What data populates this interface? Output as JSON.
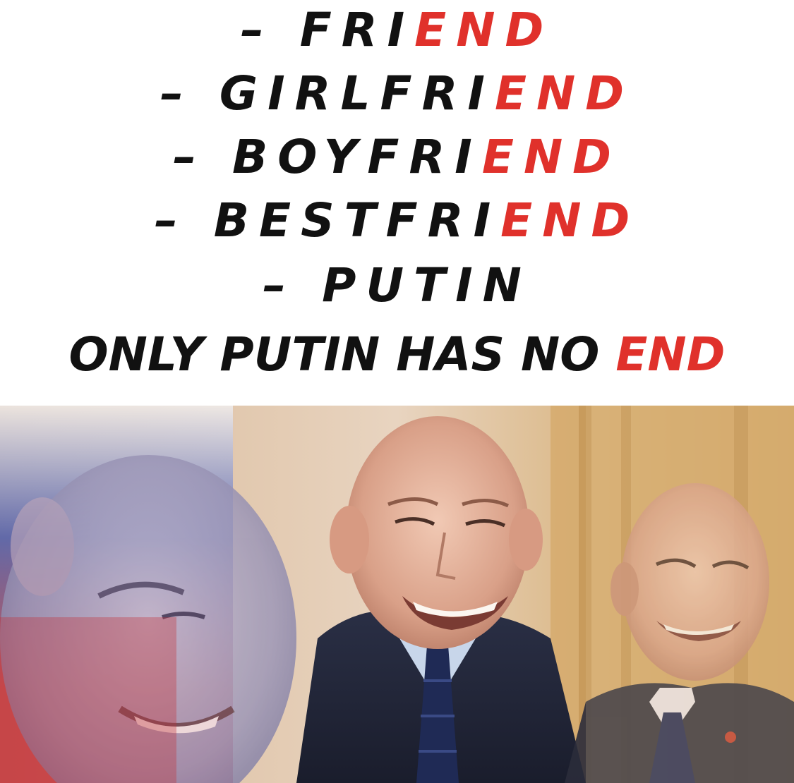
{
  "caption": {
    "lines": [
      {
        "prefix": "– FRI",
        "suffix": "END"
      },
      {
        "prefix": "– GIRLFRI",
        "suffix": "END"
      },
      {
        "prefix": "– BOYFRI",
        "suffix": "END"
      },
      {
        "prefix": "– BESTFRI",
        "suffix": "END"
      },
      {
        "prefix": "– PUTIN",
        "suffix": ""
      }
    ],
    "punchline": {
      "prefix": "ONLY PUTIN HAS NO ",
      "suffix": "END"
    }
  },
  "colors": {
    "text": "#111111",
    "accent": "#e0312b",
    "background": "#ffffff"
  }
}
